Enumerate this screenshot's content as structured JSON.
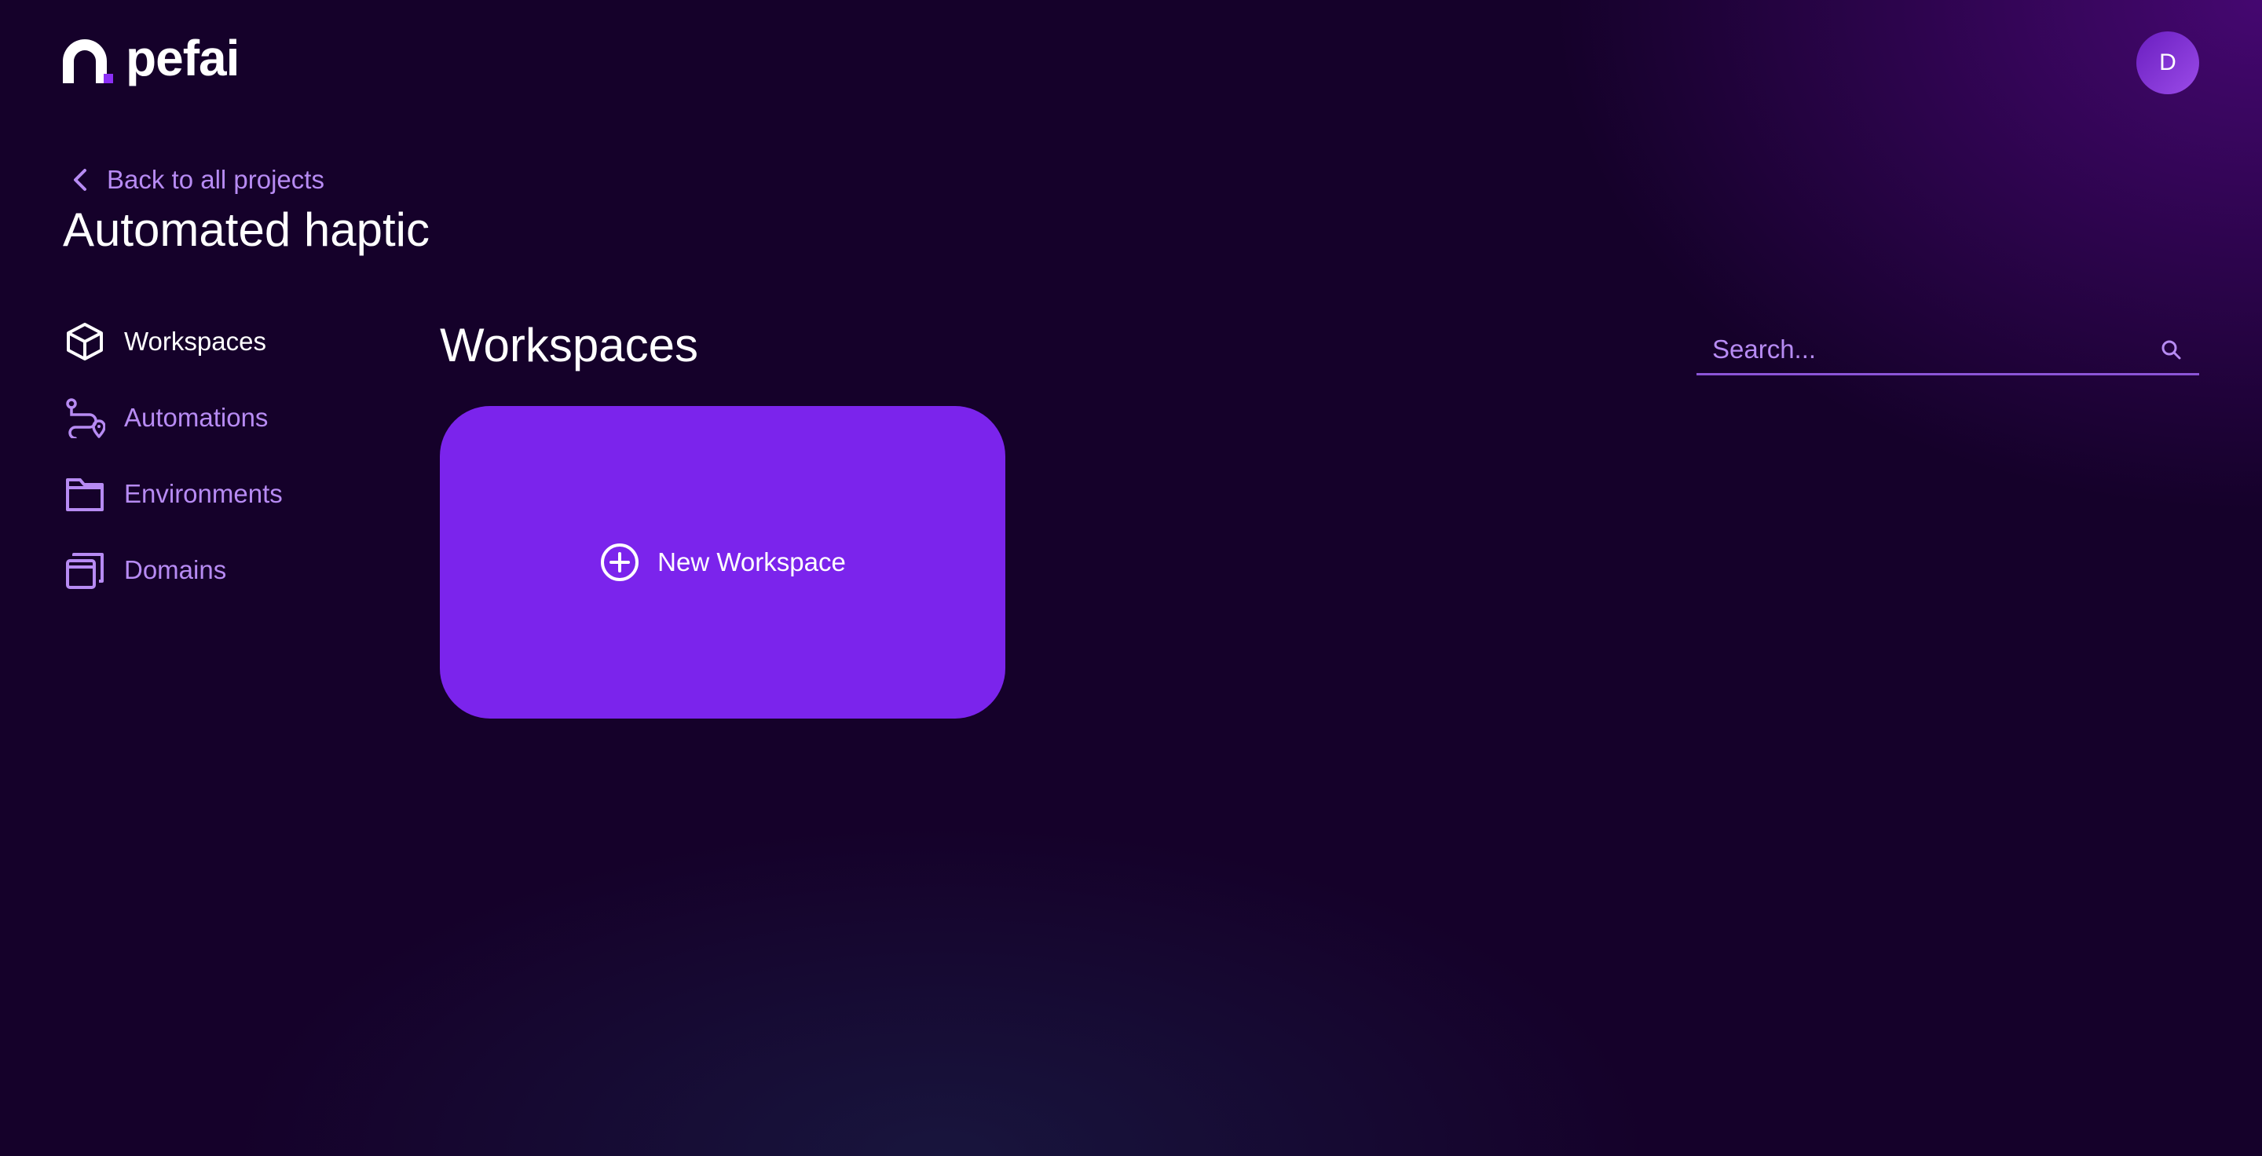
{
  "header": {
    "logo_text": "pefai",
    "avatar_initial": "D"
  },
  "back": {
    "label": "Back to all projects"
  },
  "project": {
    "title": "Automated haptic"
  },
  "sidebar": {
    "items": [
      {
        "label": "Workspaces",
        "icon": "cube-icon",
        "active": true
      },
      {
        "label": "Automations",
        "icon": "route-icon",
        "active": false
      },
      {
        "label": "Environments",
        "icon": "folder-icon",
        "active": false
      },
      {
        "label": "Domains",
        "icon": "windows-icon",
        "active": false
      }
    ]
  },
  "main": {
    "title": "Workspaces",
    "search_placeholder": "Search...",
    "new_workspace_label": "New Workspace"
  },
  "colors": {
    "background": "#15012a",
    "accent": "#7b24ec",
    "muted_text": "#b78bf3"
  }
}
